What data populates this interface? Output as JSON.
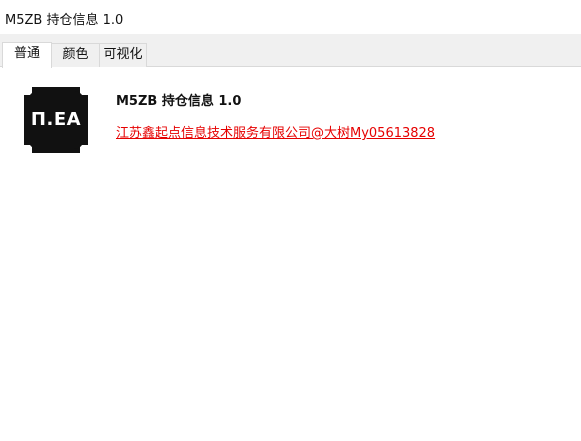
{
  "window": {
    "title": "M5ZB 持仓信息 1.0"
  },
  "tabs": [
    {
      "label": "普通",
      "active": true
    },
    {
      "label": "颜色",
      "active": false
    },
    {
      "label": "可视化",
      "active": false
    }
  ],
  "about": {
    "logo_text": "Π.EA",
    "app_name": "M5ZB 持仓信息 1.0",
    "company_link": "江苏鑫起点信息技术服务有限公司@大树My05613828",
    "link_color": "#e60000"
  }
}
